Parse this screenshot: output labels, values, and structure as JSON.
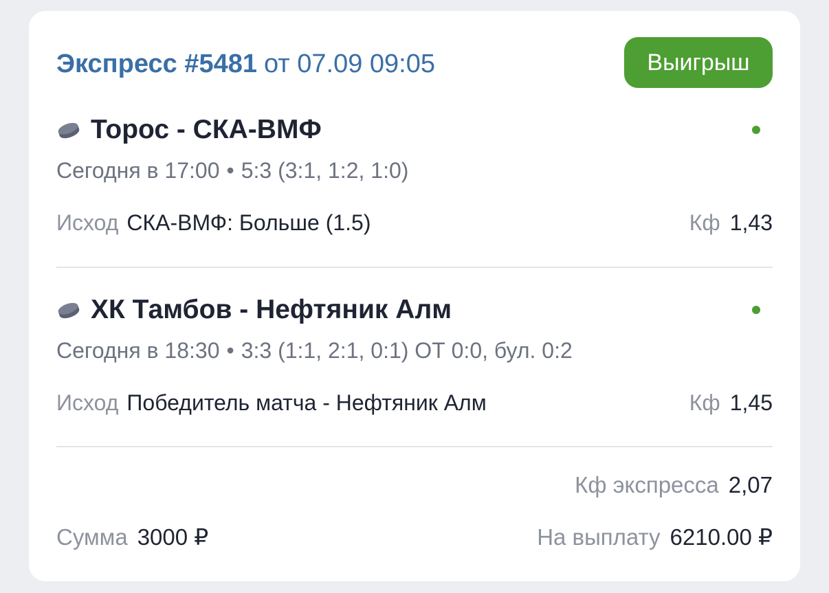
{
  "bet": {
    "title_prefix": "Экспресс #5481",
    "date_text": "от 07.09 09:05",
    "status_label": "Выигрыш"
  },
  "events": [
    {
      "sport_icon": "hockey-puck-icon",
      "name": "Торос - СКА-ВМФ",
      "time": "Сегодня в 17:00",
      "separator": "•",
      "score": "5:3 (3:1, 1:2, 1:0)",
      "outcome_label": "Исход",
      "outcome_value": "СКА-ВМФ: Больше (1.5)",
      "coef_label": "Кф",
      "coef_value": "1,43"
    },
    {
      "sport_icon": "hockey-puck-icon",
      "name": "ХК Тамбов - Нефтяник Алм",
      "time": "Сегодня в 18:30",
      "separator": "•",
      "score": "3:3 (1:1, 2:1, 0:1) ОТ 0:0, бул. 0:2",
      "outcome_label": "Исход",
      "outcome_value": "Победитель матча - Нефтяник Алм",
      "coef_label": "Кф",
      "coef_value": "1,45"
    }
  ],
  "summary": {
    "express_coef_label": "Кф экспресса",
    "express_coef_value": "2,07",
    "stake_label": "Сумма",
    "stake_value": "3000 ₽",
    "payout_label": "На выплату",
    "payout_value": "6210.00 ₽"
  },
  "colors": {
    "title": "#3a6fa6",
    "status_bg": "#4d9e33",
    "live_dot": "#4d9e33",
    "text_dark": "#1f2433",
    "text_muted": "#8d929d",
    "background": "#eceef2"
  }
}
